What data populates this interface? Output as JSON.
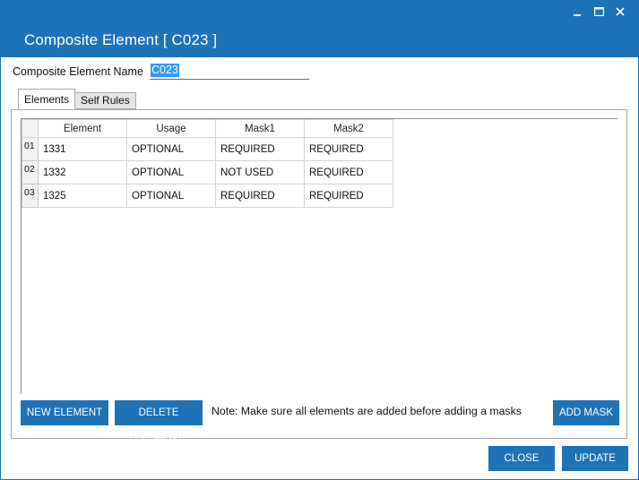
{
  "window": {
    "controls": [
      {
        "name": "minimize-icon",
        "glyph": "minimize"
      },
      {
        "name": "maximize-icon",
        "glyph": "maximize"
      },
      {
        "name": "close-icon",
        "glyph": "close"
      }
    ]
  },
  "header": {
    "title": "Composite Element [ C023 ]"
  },
  "form": {
    "name_label": "Composite Element Name",
    "name_value": "C023"
  },
  "tabs": [
    {
      "label": "Elements",
      "active": true
    },
    {
      "label": "Self Rules",
      "active": false
    }
  ],
  "grid": {
    "columns": [
      "Element",
      "Usage",
      "Mask1",
      "Mask2"
    ],
    "rows": [
      {
        "num": "01",
        "cells": [
          "1331",
          "OPTIONAL",
          "REQUIRED",
          "REQUIRED"
        ]
      },
      {
        "num": "02",
        "cells": [
          "1332",
          "OPTIONAL",
          "NOT USED",
          "REQUIRED"
        ]
      },
      {
        "num": "03",
        "cells": [
          "1325",
          "OPTIONAL",
          "REQUIRED",
          "REQUIRED"
        ]
      }
    ]
  },
  "panel": {
    "new_element": "NEW ELEMENT",
    "delete_element": "DELETE ELEMENT",
    "note": "Note: Make sure all elements are added before adding a masks",
    "add_mask": "ADD MASK"
  },
  "footer": {
    "close": "CLOSE",
    "update": "UPDATE"
  },
  "colors": {
    "accent": "#1e72b8",
    "selection": "#3399ff"
  }
}
